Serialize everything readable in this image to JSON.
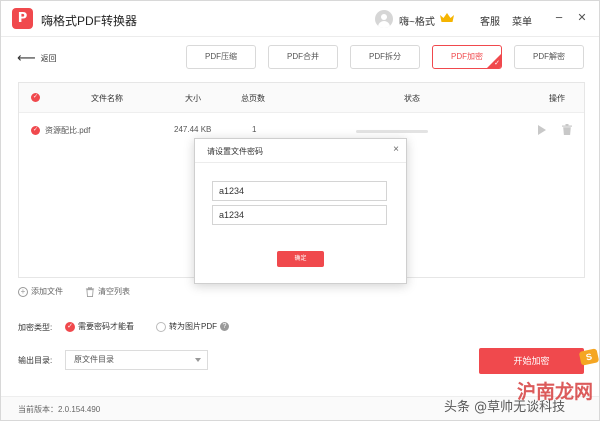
{
  "titlebar": {
    "logo_text": "P",
    "app_title": "嗨格式PDF转换器",
    "user_name": "嗨~格式",
    "service_label": "客服",
    "menu_label": "菜单",
    "minimize_glyph": "−",
    "close_glyph": "✕",
    "vip_color": "#f5b400"
  },
  "toolbar": {
    "back_label": "返回",
    "back_glyph": "⟵",
    "tabs": [
      {
        "label": "PDF压缩",
        "active": false
      },
      {
        "label": "PDF合并",
        "active": false
      },
      {
        "label": "PDF拆分",
        "active": false
      },
      {
        "label": "PDF加密",
        "active": true
      },
      {
        "label": "PDF解密",
        "active": false
      }
    ]
  },
  "table": {
    "headers": {
      "name": "文件名称",
      "size": "大小",
      "pages": "总页数",
      "status": "状态",
      "actions": "操作"
    },
    "rows": [
      {
        "name": "资源配比.pdf",
        "size": "247.44 KB",
        "pages": "1",
        "progress": 0
      }
    ]
  },
  "list_actions": {
    "add_file": "添加文件",
    "clear_list": "清空列表"
  },
  "options": {
    "encrypt_type_label": "加密类型:",
    "option_password": "需要密码才能看",
    "option_image_pdf": "转为图片PDF",
    "help_glyph": "?",
    "output_dir_label": "输出目录:",
    "output_dir_value": "原文件目录"
  },
  "start_button": "开始加密",
  "version": "当前版本：2.0.154.490",
  "modal": {
    "title": "请设置文件密码",
    "close_glyph": "×",
    "password": "a1234",
    "confirm_password": "a1234",
    "confirm_label": "确定"
  },
  "watermark": {
    "site": "沪南龙网",
    "author": "头条 @草帅无谈科技",
    "logo_text": "S"
  },
  "colors": {
    "accent": "#f0494d"
  }
}
